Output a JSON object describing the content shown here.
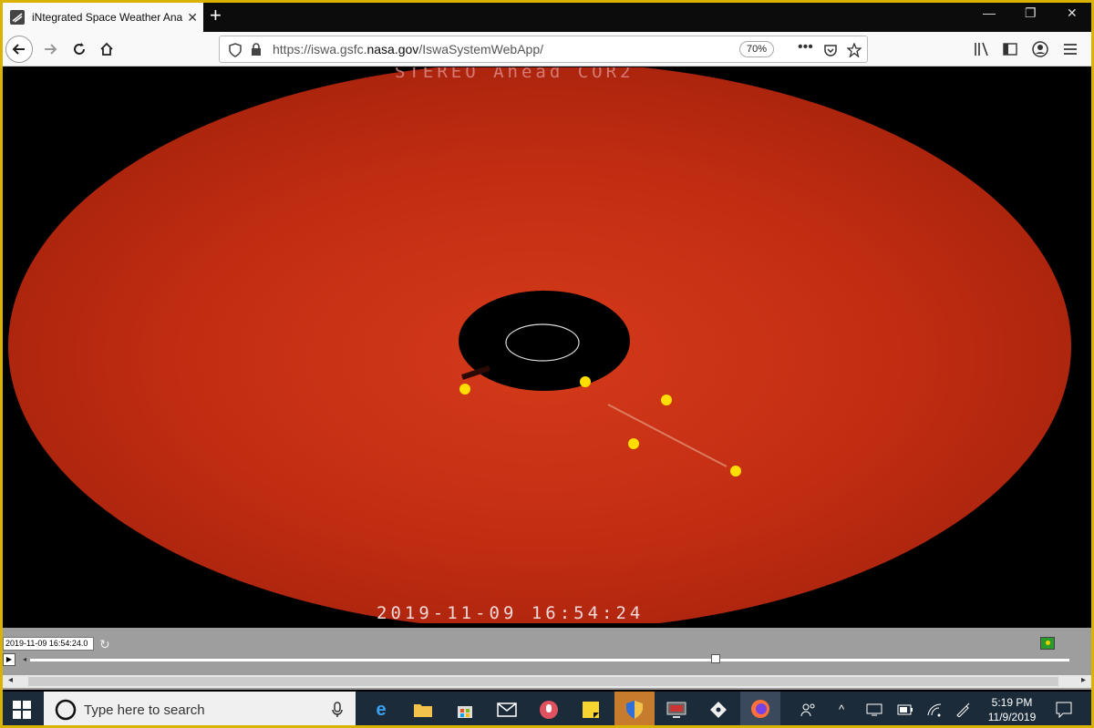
{
  "browser": {
    "tab_title": "iNtegrated Space Weather Ana",
    "url_prefix": "https://iswa.gsfc.",
    "url_domain": "nasa.gov",
    "url_path": "/IswaSystemWebApp/",
    "zoom": "70%"
  },
  "image": {
    "title": "STEREO Ahead COR2",
    "timestamp": "2019-11-09  16:54:24"
  },
  "player": {
    "date_value": "2019-11-09 16:54:24.0",
    "slider_fraction": 0.66
  },
  "taskbar": {
    "search_placeholder": "Type here to search",
    "time": "5:19 PM",
    "date": "11/9/2019"
  },
  "colors": {
    "corona": "#b82a10",
    "marker": "#ffde00",
    "taskbar": "#1c2b3a",
    "frame": "#d9b300"
  }
}
